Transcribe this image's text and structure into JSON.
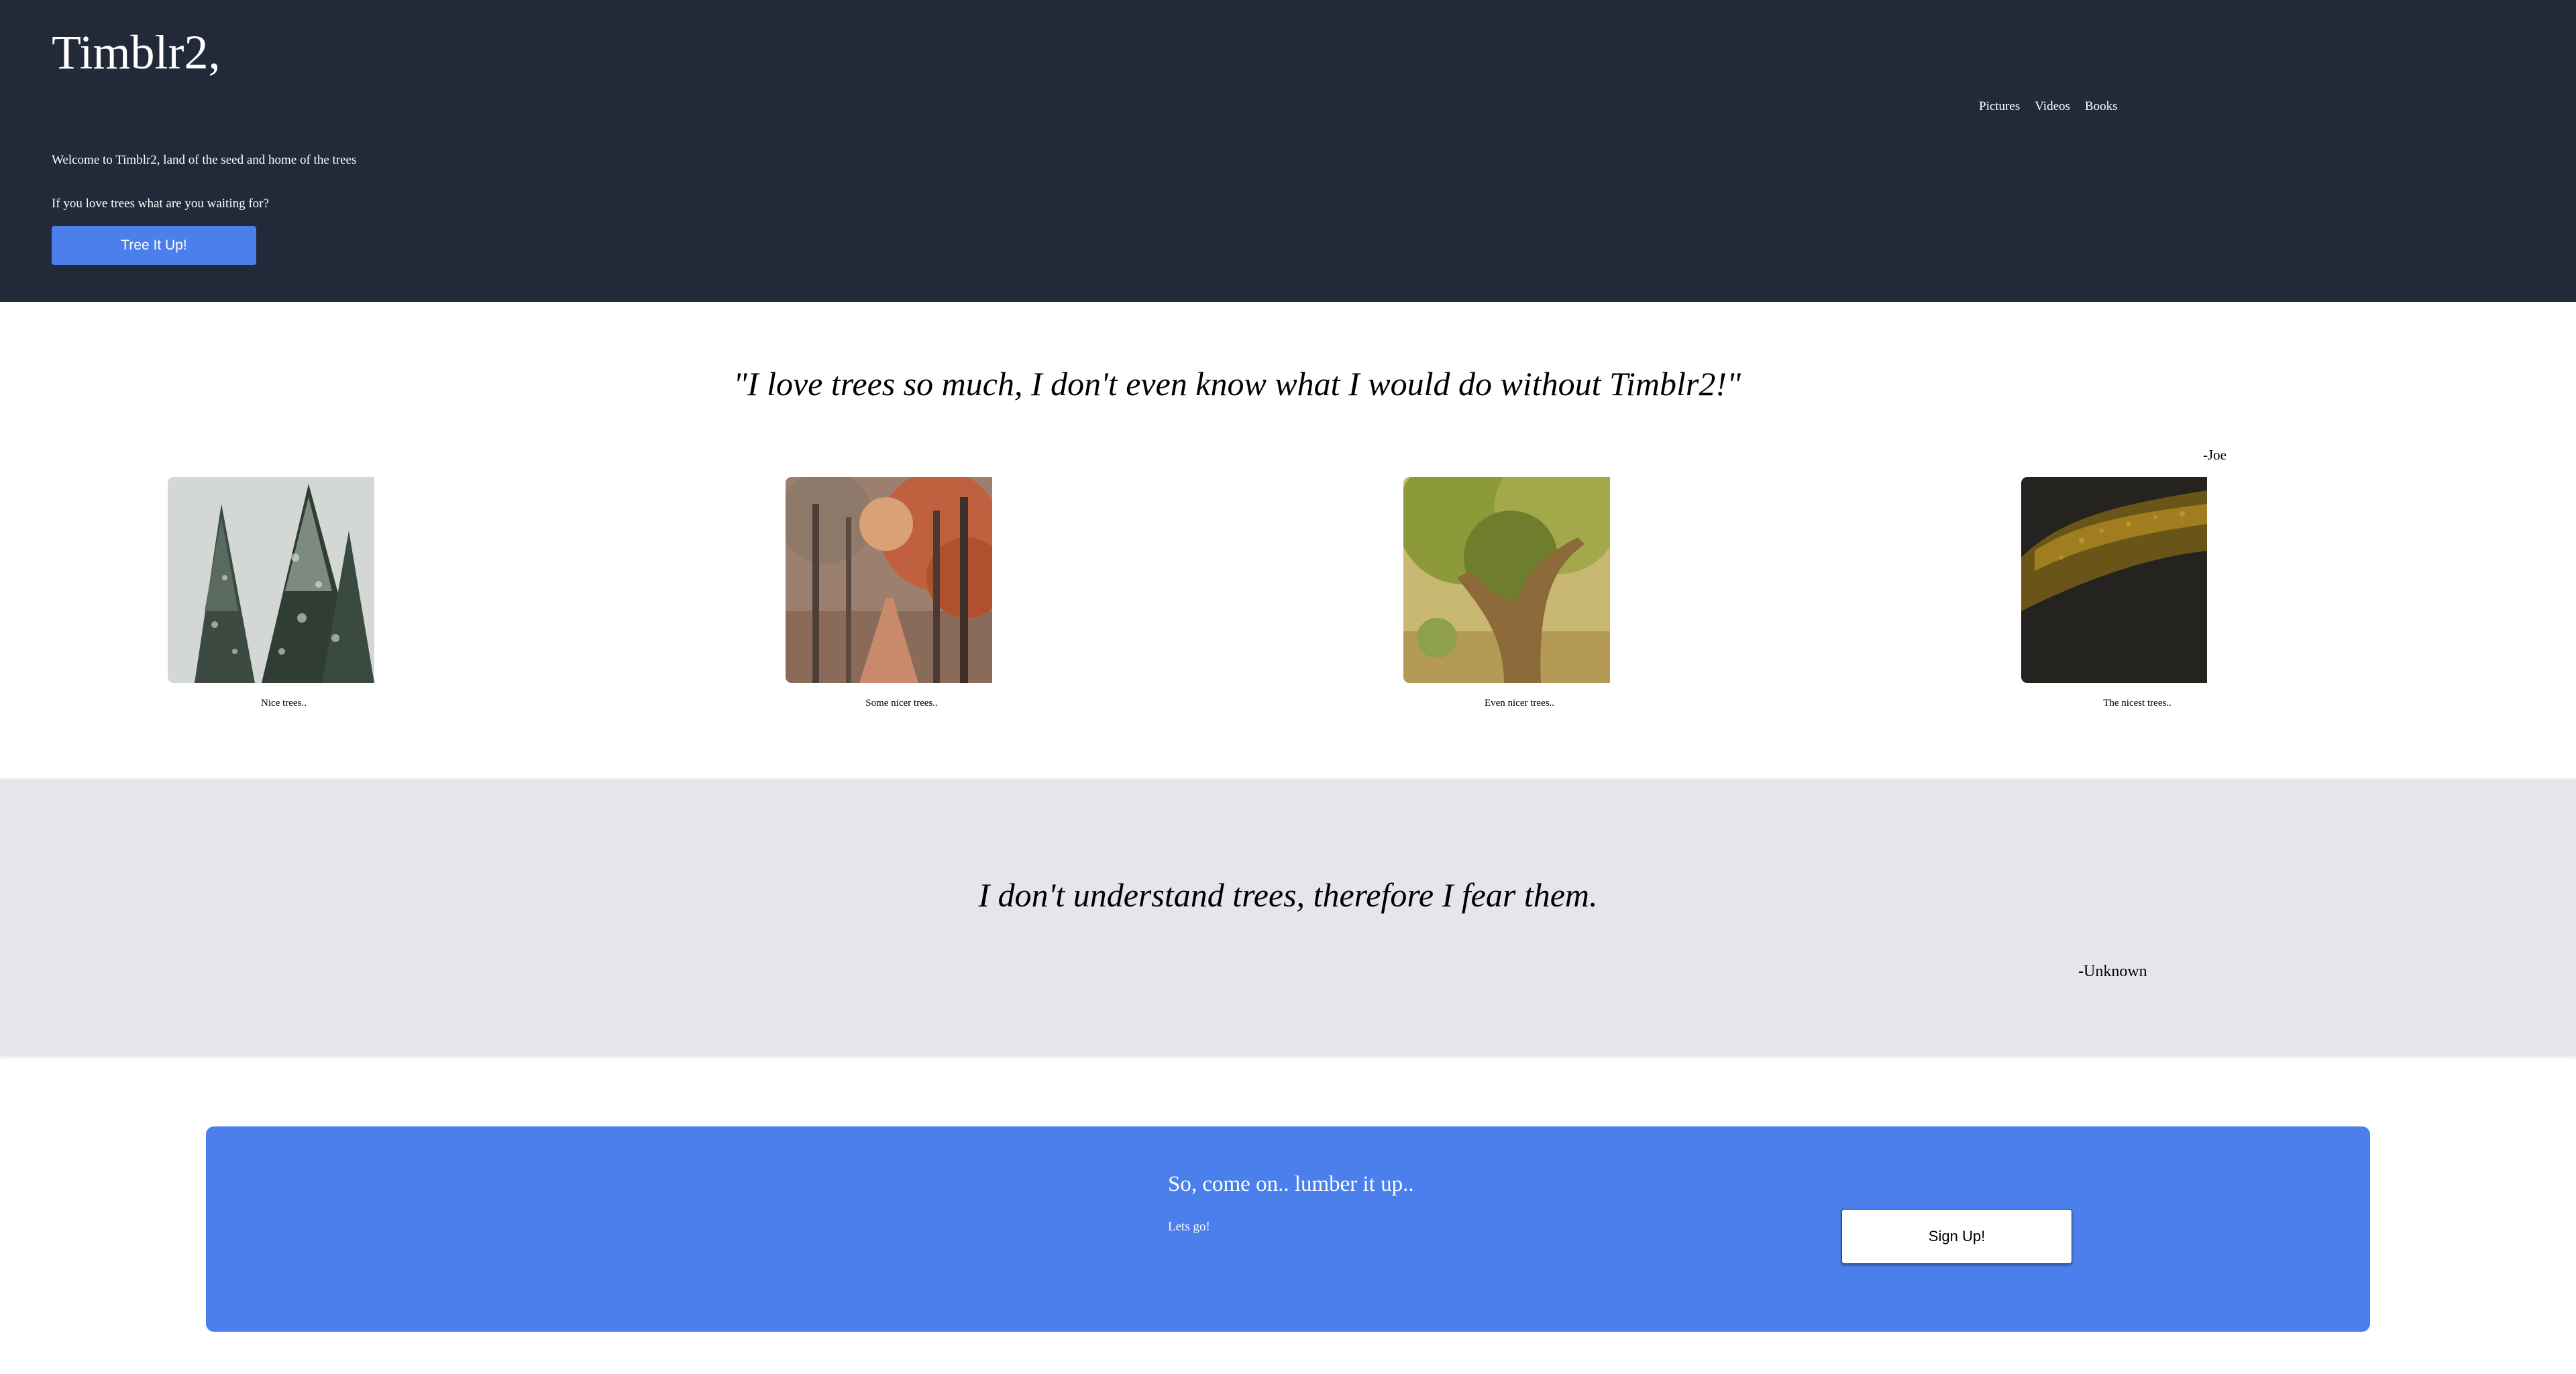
{
  "header": {
    "title": "Timblr2,",
    "nav": [
      "Pictures",
      "Videos",
      "Books"
    ],
    "welcome": "Welcome to Timblr2, land of the seed and home of the trees",
    "prompt": "If you love trees what are you waiting for?",
    "cta_label": "Tree It Up!"
  },
  "testimonial": {
    "quote": "\"I love trees so much, I don't even know what I would do without Timblr2!\"",
    "author": "-Joe"
  },
  "gallery": [
    {
      "caption": "Nice trees..",
      "image": "snowy-pine-trees"
    },
    {
      "caption": "Some nicer trees..",
      "image": "autumn-tree-avenue"
    },
    {
      "caption": "Even nicer trees..",
      "image": "large-oak-tree"
    },
    {
      "caption": "The nicest trees..",
      "image": "dark-forest-hillside"
    }
  ],
  "quote_band": {
    "quote": "I don't understand trees, therefore I fear them.",
    "author": "-Unknown"
  },
  "signup": {
    "heading": "So, come on.. lumber it up..",
    "subheading": "Lets go!",
    "button_label": "Sign Up!"
  },
  "colors": {
    "header_bg": "#222939",
    "accent": "#4a7fec",
    "band_bg": "#e5e6e9"
  }
}
